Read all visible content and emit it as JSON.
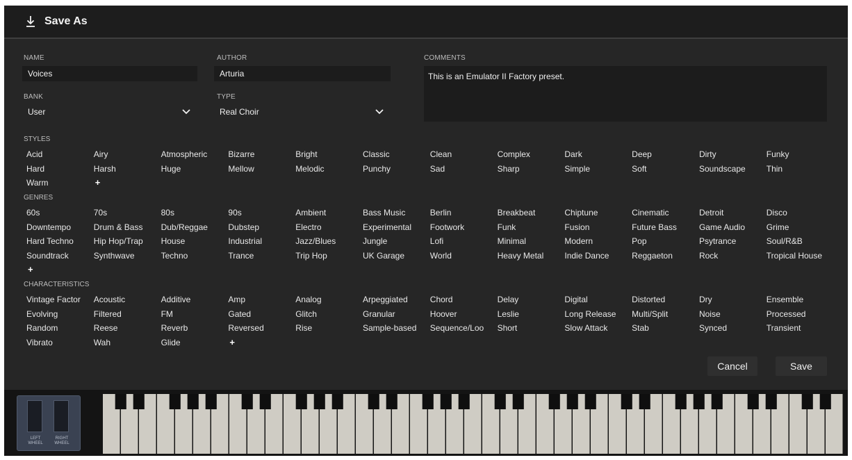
{
  "dialog": {
    "title": "Save As",
    "icon": "download-icon"
  },
  "form": {
    "name_label": "NAME",
    "name_value": "Voices",
    "author_label": "AUTHOR",
    "author_value": "Arturia",
    "comments_label": "COMMENTS",
    "comments_value": "This is an Emulator II Factory preset.",
    "bank_label": "BANK",
    "bank_value": "User",
    "type_label": "TYPE",
    "type_value": "Real Choir"
  },
  "styles": {
    "label": "STYLES",
    "tags": [
      "Acid",
      "Airy",
      "Atmospheric",
      "Bizarre",
      "Bright",
      "Classic",
      "Clean",
      "Complex",
      "Dark",
      "Deep",
      "Dirty",
      "Funky",
      "Hard",
      "Harsh",
      "Huge",
      "Mellow",
      "Melodic",
      "Punchy",
      "Sad",
      "Sharp",
      "Simple",
      "Soft",
      "Soundscape",
      "Thin",
      "Warm"
    ],
    "add": "+"
  },
  "genres": {
    "label": "GENRES",
    "tags": [
      "60s",
      "70s",
      "80s",
      "90s",
      "Ambient",
      "Bass Music",
      "Berlin",
      "Breakbeat",
      "Chiptune",
      "Cinematic",
      "Detroit",
      "Disco",
      "Downtempo",
      "Drum & Bass",
      "Dub/Reggae",
      "Dubstep",
      "Electro",
      "Experimental",
      "Footwork",
      "Funk",
      "Fusion",
      "Future Bass",
      "Game Audio",
      "Grime",
      "Hard Techno",
      "Hip Hop/Trap",
      "House",
      "Industrial",
      "Jazz/Blues",
      "Jungle",
      "Lofi",
      "Minimal",
      "Modern",
      "Pop",
      "Psytrance",
      "Soul/R&B",
      "Soundtrack",
      "Synthwave",
      "Techno",
      "Trance",
      "Trip Hop",
      "UK Garage",
      "World",
      "Heavy Metal",
      "Indie Dance",
      "Reggaeton",
      "Rock",
      "Tropical House"
    ],
    "add": "+"
  },
  "characteristics": {
    "label": "CHARACTERISTICS",
    "tags": [
      "Vintage Factor",
      "Acoustic",
      "Additive",
      "Amp",
      "Analog",
      "Arpeggiated",
      "Chord",
      "Delay",
      "Digital",
      "Distorted",
      "Dry",
      "Ensemble",
      "Evolving",
      "Filtered",
      "FM",
      "Gated",
      "Glitch",
      "Granular",
      "Hoover",
      "Leslie",
      "Long Release",
      "Multi/Split",
      "Noise",
      "Processed",
      "Random",
      "Reese",
      "Reverb",
      "Reversed",
      "Rise",
      "Sample-based",
      "Sequence/Loo",
      "Short",
      "Slow Attack",
      "Stab",
      "Synced",
      "Transient",
      "Vibrato",
      "Wah",
      "Glide"
    ],
    "add": "+"
  },
  "buttons": {
    "cancel": "Cancel",
    "save": "Save"
  },
  "keyboard": {
    "left_wheel": "LEFT WHEEL",
    "right_wheel": "RIGHT WHEEL"
  },
  "colors": {
    "dialog_bg": "#262626",
    "titlebar_bg": "#1d1d1d",
    "field_bg": "#1c1c1c",
    "text": "#e8e8e8",
    "label_text": "#bdbdbd"
  }
}
